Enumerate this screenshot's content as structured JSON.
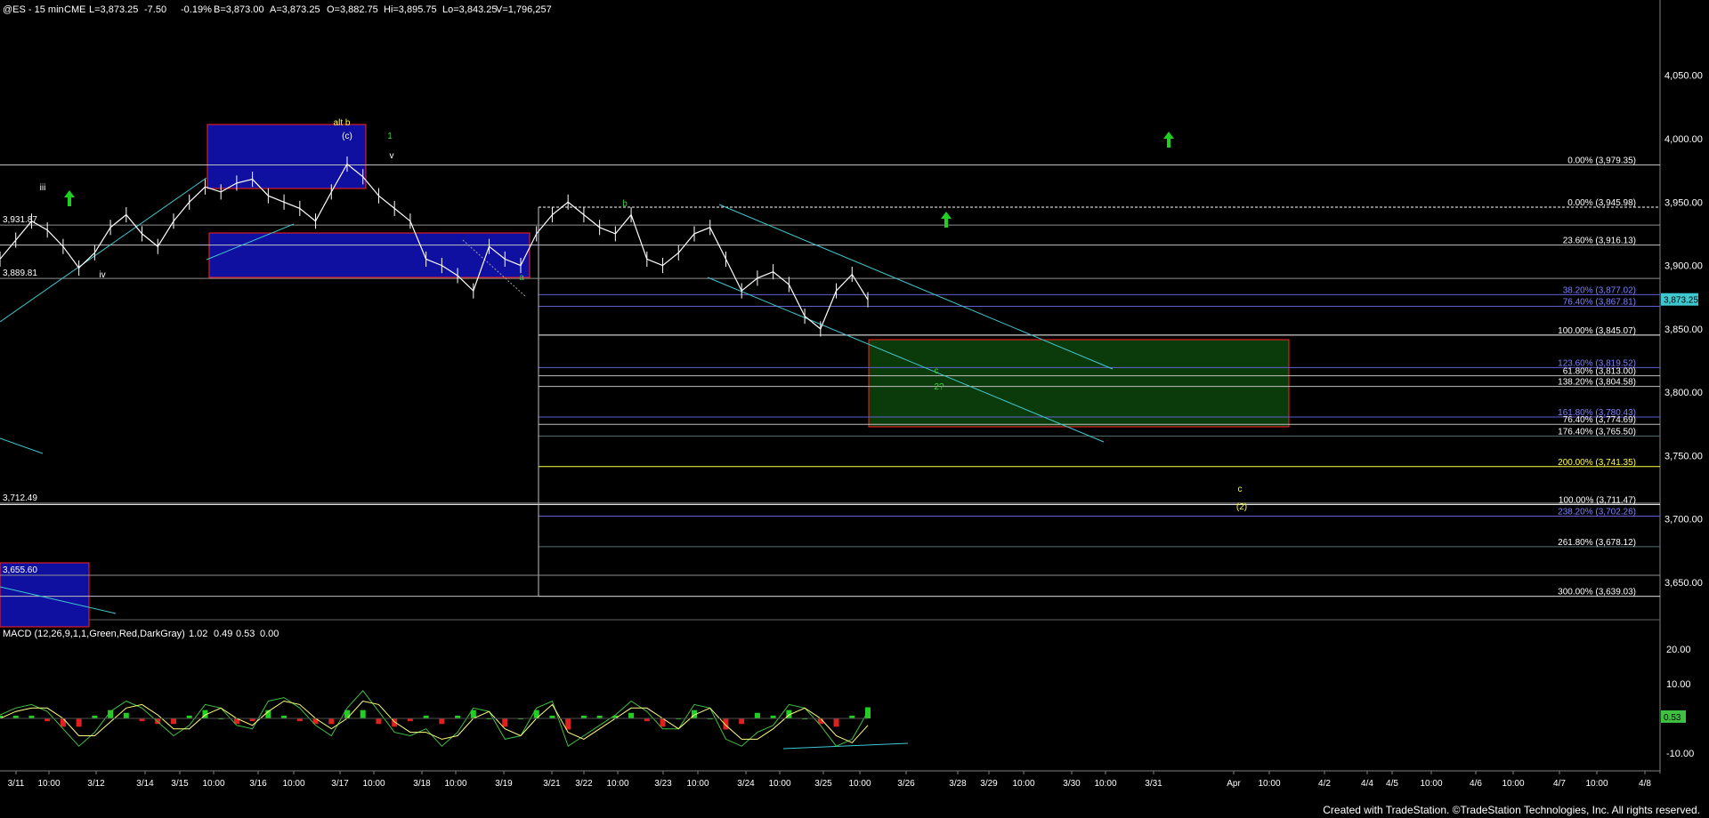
{
  "header": {
    "symbol": "@ES - 15 min",
    "exchange": "CME",
    "last": "L=3,873.25",
    "change": "-7.50",
    "change_pct": "-0.19%",
    "bid": "B=3,873.00",
    "ask": "A=3,873.25",
    "open": "O=3,882.75",
    "high": "Hi=3,895.75",
    "low": "Lo=3,843.25",
    "volume": "V=1,796,257"
  },
  "footer": {
    "text": "Created with TradeStation. ©TradeStation Technologies, Inc. All rights reserved."
  },
  "colors": {
    "background": "#000000",
    "price": "#ffffff",
    "blue_box": "#1010a0",
    "blue_box_border": "#ff2020",
    "green_box": "#0b3a0b",
    "green_box_border": "#ff2020",
    "trend": "#40c8d0",
    "arrow": "#20d020",
    "macd_line": "#40c040",
    "signal_line": "#ffff80",
    "hist_up": "#20d020",
    "hist_down": "#e02020",
    "wave_yellow": "#ffff40",
    "wave_green": "#40d040"
  },
  "chart_data": [
    {
      "type": "line",
      "title": "@ES - 15 min",
      "y_axis_side": "right",
      "ylim": [
        3610,
        4100
      ],
      "y_ticks": [
        3650,
        3700,
        3750,
        3800,
        3850,
        3900,
        3950,
        4000,
        4050
      ],
      "y_tick_labels": [
        "3,650.00",
        "3,700.00",
        "3,750.00",
        "3,800.00",
        "3,850.00",
        "3,900.00",
        "3,950.00",
        "4,000.00",
        "4,050.00"
      ],
      "x_labels": [
        "3/11",
        "10:00",
        "3/12",
        "3/14",
        "3/15",
        "10:00",
        "3/16",
        "10:00",
        "3/17",
        "10:00",
        "3/18",
        "10:00",
        "3/19",
        "3/21",
        "3/22",
        "10:00",
        "3/23",
        "10:00",
        "3/24",
        "10:00",
        "3/25",
        "10:00",
        "3/26",
        "3/28",
        "3/29",
        "10:00",
        "3/30",
        "10:00",
        "3/31",
        "Apr",
        "10:00",
        "4/2",
        "4/4",
        "4/5",
        "10:00",
        "4/6",
        "10:00",
        "4/7",
        "10:00",
        "4/8"
      ],
      "price_series": {
        "name": "@ES",
        "y": [
          3905,
          3920,
          3935,
          3928,
          3915,
          3898,
          3910,
          3930,
          3940,
          3925,
          3915,
          3935,
          3950,
          3962,
          3958,
          3965,
          3968,
          3955,
          3950,
          3945,
          3935,
          3958,
          3980,
          3970,
          3955,
          3945,
          3935,
          3905,
          3900,
          3892,
          3880,
          3915,
          3905,
          3900,
          3925,
          3940,
          3950,
          3940,
          3930,
          3925,
          3940,
          3905,
          3900,
          3910,
          3925,
          3930,
          3905,
          3880,
          3890,
          3895,
          3885,
          3860,
          3850,
          3880,
          3893,
          3873
        ]
      },
      "price_labels_left": [
        "3,931.87",
        "3,889.81",
        "3,712.49",
        "3,655.60"
      ],
      "last_price_label": "3,873.25",
      "fib_levels": [
        {
          "label": "0.00% (3,979.35)",
          "price": 3979.35
        },
        {
          "label": "0.00% (3,945.98)",
          "price": 3945.98
        },
        {
          "label": "23.60% (3,916.13)",
          "price": 3916.13
        },
        {
          "label": "38.20% (3,877.02)",
          "price": 3877.02
        },
        {
          "label": "76.40% (3,867.81)",
          "price": 3867.81
        },
        {
          "label": "100.00% (3,845.07)",
          "price": 3845.07
        },
        {
          "label": "123.60% (3,819.52)",
          "price": 3819.52
        },
        {
          "label": "61.80% (3,813.00)",
          "price": 3813.0
        },
        {
          "label": "138.20% (3,804.58)",
          "price": 3804.58
        },
        {
          "label": "161.80% (3,780.43)",
          "price": 3780.43
        },
        {
          "label": "76.40% (3,774.69)",
          "price": 3774.69
        },
        {
          "label": "176.40% (3,765.50)",
          "price": 3765.5
        },
        {
          "label": "200.00% (3,741.35)",
          "price": 3741.35
        },
        {
          "label": "100.00% (3,711.47)",
          "price": 3711.47
        },
        {
          "label": "238.20% (3,702.26)",
          "price": 3702.26
        },
        {
          "label": "261.80% (3,678.12)",
          "price": 3678.12
        },
        {
          "label": "300.00% (3,639.03)",
          "price": 3639.03
        }
      ],
      "wave_labels": [
        {
          "text": "iii",
          "color": "#ffffff"
        },
        {
          "text": "iv",
          "color": "#ffffff"
        },
        {
          "text": "alt b",
          "color": "#ffff40"
        },
        {
          "text": "(c)",
          "color": "#ffffff"
        },
        {
          "text": "1",
          "color": "#40d040"
        },
        {
          "text": "v",
          "color": "#ffffff"
        },
        {
          "text": "a",
          "color": "#40d040"
        },
        {
          "text": "b",
          "color": "#40d040"
        },
        {
          "text": "c",
          "color": "#40d040"
        },
        {
          "text": "2?",
          "color": "#40d040"
        },
        {
          "text": "c",
          "color": "#ffff40"
        },
        {
          "text": "(2)",
          "color": "#ffff40"
        }
      ]
    },
    {
      "type": "line",
      "title": "MACD (12,26,9,1,1,Green,Red,DarkGray)",
      "values_text": [
        "1.02",
        "0.49",
        "0.53",
        "0.00"
      ],
      "ylim": [
        -14,
        25
      ],
      "y_ticks": [
        -10,
        0,
        10,
        20
      ],
      "y_tick_labels": [
        "-10.00",
        "0.00",
        "10.00",
        "20.00"
      ],
      "last_value_label": "0.53",
      "series": [
        {
          "name": "MACD",
          "values": [
            1,
            3,
            4,
            2,
            -3,
            -8,
            -4,
            2,
            5,
            3,
            -1,
            -5,
            -2,
            4,
            3,
            -2,
            -3,
            5,
            6,
            3,
            -2,
            -5,
            3,
            8,
            2,
            -4,
            -5,
            -3,
            -8,
            -4,
            3,
            2,
            -6,
            -5,
            3,
            5,
            -8,
            -5,
            -2,
            1,
            5,
            2,
            -3,
            -3,
            4,
            3,
            -6,
            -8,
            -4,
            -2,
            4,
            3,
            -2,
            -8,
            -6,
            2
          ]
        },
        {
          "name": "Signal",
          "values": [
            0,
            2,
            3,
            3,
            0,
            -5,
            -5,
            -1,
            3,
            4,
            1,
            -3,
            -3,
            1,
            3,
            0,
            -2,
            2,
            5,
            4,
            0,
            -3,
            0,
            5,
            4,
            -1,
            -4,
            -4,
            -6,
            -5,
            0,
            2,
            -3,
            -5,
            0,
            4,
            -4,
            -6,
            -3,
            0,
            3,
            3,
            0,
            -3,
            1,
            3,
            -2,
            -6,
            -6,
            -3,
            1,
            3,
            0,
            -5,
            -7,
            -2
          ]
        }
      ]
    }
  ]
}
